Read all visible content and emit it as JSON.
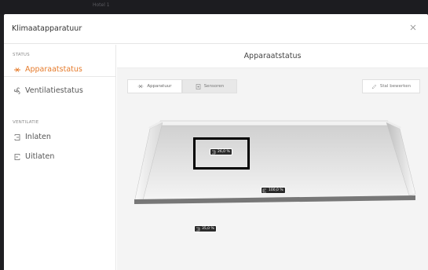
{
  "background_bar": {
    "ghost_text": "Hotel 1"
  },
  "dialog": {
    "title": "Klimaatapparatuur",
    "close_icon": "close-icon"
  },
  "sidebar": {
    "sections": [
      {
        "label": "STATUS",
        "items": [
          {
            "label": "Apparaatstatus",
            "icon": "fan-outline-icon",
            "active": true
          },
          {
            "label": "Ventilatiestatus",
            "icon": "ventilation-icon",
            "active": false
          }
        ]
      },
      {
        "label": "VENTILATIE",
        "items": [
          {
            "label": "Inlaten",
            "icon": "inlet-icon",
            "active": false
          },
          {
            "label": "Uitlaten",
            "icon": "outlet-icon",
            "active": false
          }
        ]
      }
    ]
  },
  "main": {
    "title": "Apparaatstatus",
    "tabs": [
      {
        "label": "Apparatuur",
        "icon": "fan-icon",
        "selected": false
      },
      {
        "label": "Sensoren",
        "icon": "sensor-icon",
        "selected": true
      }
    ],
    "edit_button": {
      "label": "Stal bewerken",
      "icon": "edit-icon"
    },
    "badges": [
      {
        "value": "26,0 %",
        "icon": "inlet-icon"
      },
      {
        "value": "100,0 %",
        "icon": "outlet-icon"
      },
      {
        "value": "35,0 %",
        "icon": "inlet-icon"
      }
    ]
  },
  "colors": {
    "accent": "#e57a2a",
    "highlight_box": "#000000",
    "badge_bg": "#2b2b2b"
  }
}
